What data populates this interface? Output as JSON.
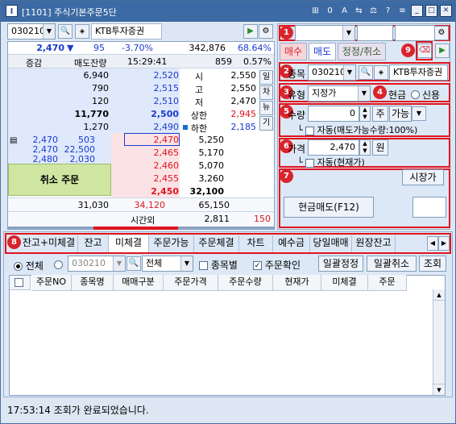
{
  "window": {
    "app_icon": "I",
    "title": "[1101] 주식기본주문5단",
    "toolbar_icons": [
      "⊞",
      "0",
      "A",
      "⇆",
      "⚖",
      "?",
      "≡"
    ],
    "controls": [
      "_",
      "□",
      "✕"
    ]
  },
  "top": {
    "code": "030210",
    "company": "KTB투자증권",
    "price": "2,470",
    "arrow": "▼",
    "change": "95",
    "change_pct": "-3.70%",
    "volume": "342,876",
    "ratio": "68.64%"
  },
  "orderbook": {
    "header": {
      "change": "증감",
      "ask_qty": "매도잔량",
      "time": "15:29:41",
      "count": "859",
      "pct": "0.57%"
    },
    "asks": [
      {
        "qty": "6,940",
        "price": "2,520"
      },
      {
        "qty": "790",
        "price": "2,515"
      },
      {
        "qty": "120",
        "price": "2,510"
      },
      {
        "qty": "11,770",
        "price": "2,500"
      },
      {
        "qty": "1,270",
        "price": "2,490"
      }
    ],
    "info": [
      {
        "label": "시",
        "value": "2,550"
      },
      {
        "label": "고",
        "value": "2,550"
      },
      {
        "label": "저",
        "value": "2,470"
      },
      {
        "label": "상한",
        "value": "2,945"
      },
      {
        "label": "하한",
        "value": "2,185"
      }
    ],
    "side_buttons": [
      "일",
      "차",
      "뉴",
      "기"
    ],
    "exec_price": [
      "2,470",
      "2,470",
      "2,480"
    ],
    "exec_qty": [
      "503",
      "22,500",
      "2,030"
    ],
    "bids": [
      {
        "price": "2,470",
        "qty": "5,250"
      },
      {
        "price": "2,465",
        "qty": "5,170"
      },
      {
        "price": "2,460",
        "qty": "5,070"
      },
      {
        "price": "2,455",
        "qty": "3,260"
      },
      {
        "price": "2,450",
        "qty": "32,100"
      }
    ],
    "cancel_order": "취소 주문",
    "sum_ask": "31,030",
    "sum_diff": "34,120",
    "sum_bid": "65,150",
    "after_label": "시간외",
    "after_value": "2,811",
    "after_diff": "150"
  },
  "order_panel": {
    "tabs": [
      "매수",
      "매도",
      "정정/취소"
    ],
    "stock_label": "종목",
    "stock_code": "030210",
    "stock_name": "KTB투자증권",
    "type_label": "유형",
    "type_value": "지정가",
    "cash": "현금",
    "credit": "신용",
    "qty_label": "수량",
    "qty_value": "0",
    "qty_unit": "주",
    "qty_avail": "가능",
    "auto_qty": "자동(매도가능수량:100%)",
    "price_label": "가격",
    "price_value": "2,470",
    "price_unit": "원",
    "auto_price": "자동(현재가)",
    "market_btn": "시장가",
    "submit": "현금매도(F12)"
  },
  "badges": [
    "1",
    "2",
    "3",
    "4",
    "5",
    "6",
    "7",
    "8",
    "9"
  ],
  "bottom": {
    "tabs": [
      "잔고+미체결",
      "잔고",
      "미체결",
      "주문가능",
      "주문체결",
      "차트",
      "예수금",
      "당일매매",
      "원장잔고"
    ],
    "filter_all": "전체",
    "filter_code": "030210",
    "filter_combo": "전체",
    "by_stock": "종목별",
    "confirm": "주문확인",
    "btn_modify": "일괄정정",
    "btn_cancel": "일괄취소",
    "btn_query": "조회",
    "columns": [
      "주문NO",
      "종목명",
      "매매구분",
      "주문가격",
      "주문수량",
      "현재가",
      "미체결",
      "주문"
    ]
  },
  "status": "17:53:14 조회가 완료되었습니다.",
  "colors": {
    "up": "#e0141e",
    "down": "#1a3ccf",
    "badge": "#d9242b"
  }
}
